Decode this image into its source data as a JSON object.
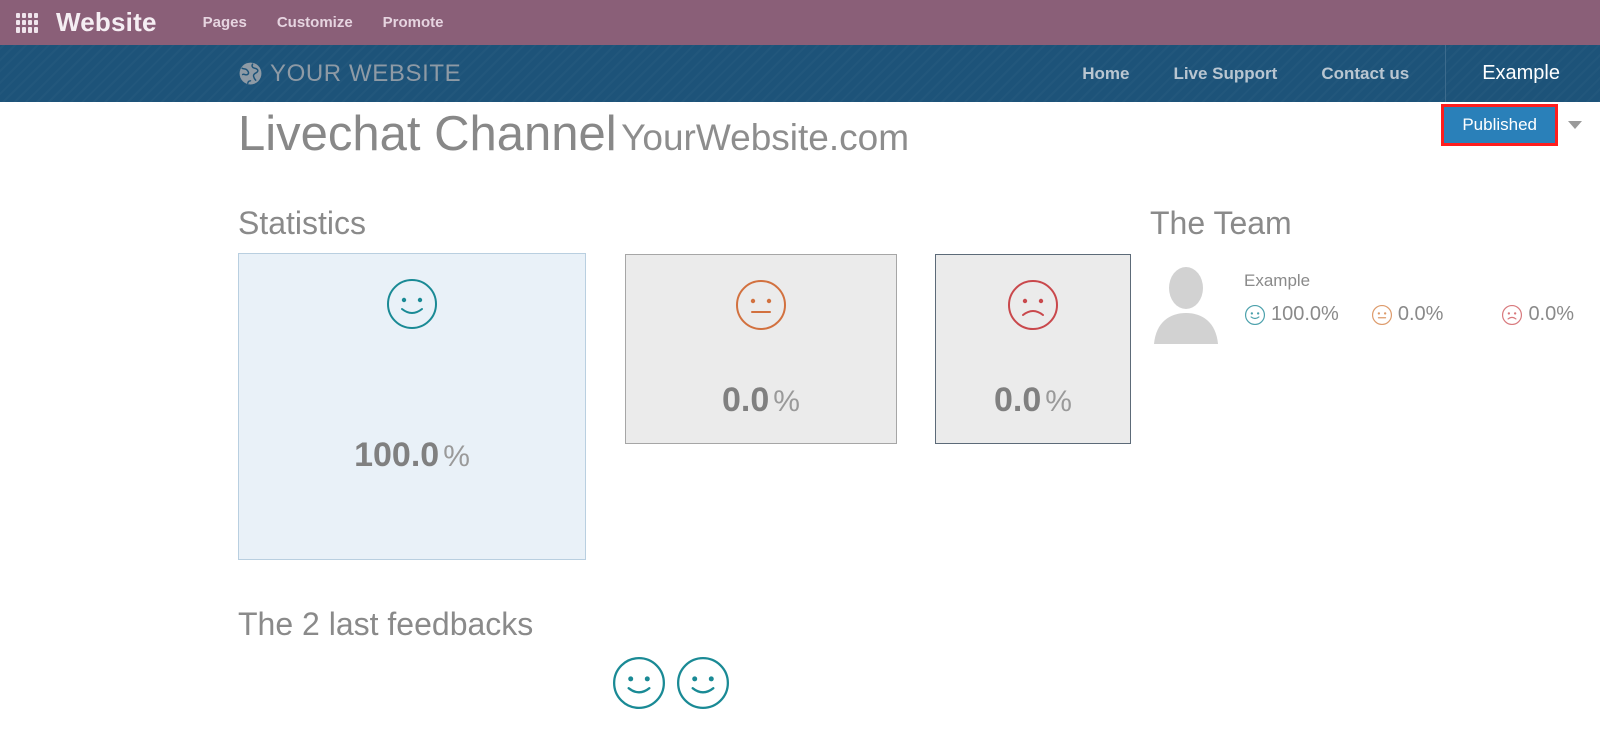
{
  "systray": {
    "apps_icon": "apps-grid-icon",
    "brand": "Website",
    "menus": [
      {
        "label": "Pages"
      },
      {
        "label": "Customize"
      },
      {
        "label": "Promote"
      }
    ]
  },
  "site_nav": {
    "logo_icon": "globe-icon",
    "logo_text": "YOUR WEBSITE",
    "links": [
      {
        "label": "Home"
      },
      {
        "label": "Live Support"
      },
      {
        "label": "Contact us"
      }
    ],
    "user": "Example"
  },
  "publish": {
    "label": "Published",
    "dropdown_icon": "chevron-down-icon",
    "highlight_color": "#ff1d1d",
    "button_color": "#2a80b9"
  },
  "page": {
    "title_main": "Livechat Channel",
    "title_sub": "YourWebsite.com",
    "statistics_heading": "Statistics",
    "team_heading": "The Team",
    "feedbacks_heading": "The 2 last feedbacks"
  },
  "statistics": {
    "cards": [
      {
        "mood": "happy",
        "icon": "happy-face-icon",
        "value": "100.0",
        "unit": "%",
        "color": "#1a8a95",
        "background": "#e9f1f8"
      },
      {
        "mood": "neutral",
        "icon": "neutral-face-icon",
        "value": "0.0",
        "unit": "%",
        "color": "#d2713f",
        "background": "#ebebeb"
      },
      {
        "mood": "sad",
        "icon": "sad-face-icon",
        "value": "0.0",
        "unit": "%",
        "color": "#c9484c",
        "background": "#ebebeb"
      }
    ]
  },
  "team": {
    "members": [
      {
        "avatar_icon": "default-avatar-icon",
        "name": "Example",
        "stats": [
          {
            "mood": "happy",
            "icon": "happy-face-icon",
            "value": "100.0%",
            "color": "#4aa0ab"
          },
          {
            "mood": "neutral",
            "icon": "neutral-face-icon",
            "value": "0.0%",
            "color": "#dd9a6a"
          },
          {
            "mood": "sad",
            "icon": "sad-face-icon",
            "value": "0.0%",
            "color": "#d8787c"
          }
        ]
      }
    ]
  },
  "feedbacks": {
    "items": [
      {
        "mood": "happy",
        "icon": "happy-face-icon",
        "color": "#1a8a95"
      },
      {
        "mood": "happy",
        "icon": "happy-face-icon",
        "color": "#1a8a95"
      }
    ]
  },
  "chart_data": {
    "type": "bar",
    "title": "Statistics",
    "categories": [
      "Happy",
      "Neutral",
      "Sad"
    ],
    "values": [
      100.0,
      0.0,
      0.0
    ],
    "unit": "%",
    "ylim": [
      0,
      100
    ],
    "xlabel": "",
    "ylabel": "",
    "grid": false,
    "legend": "none"
  }
}
